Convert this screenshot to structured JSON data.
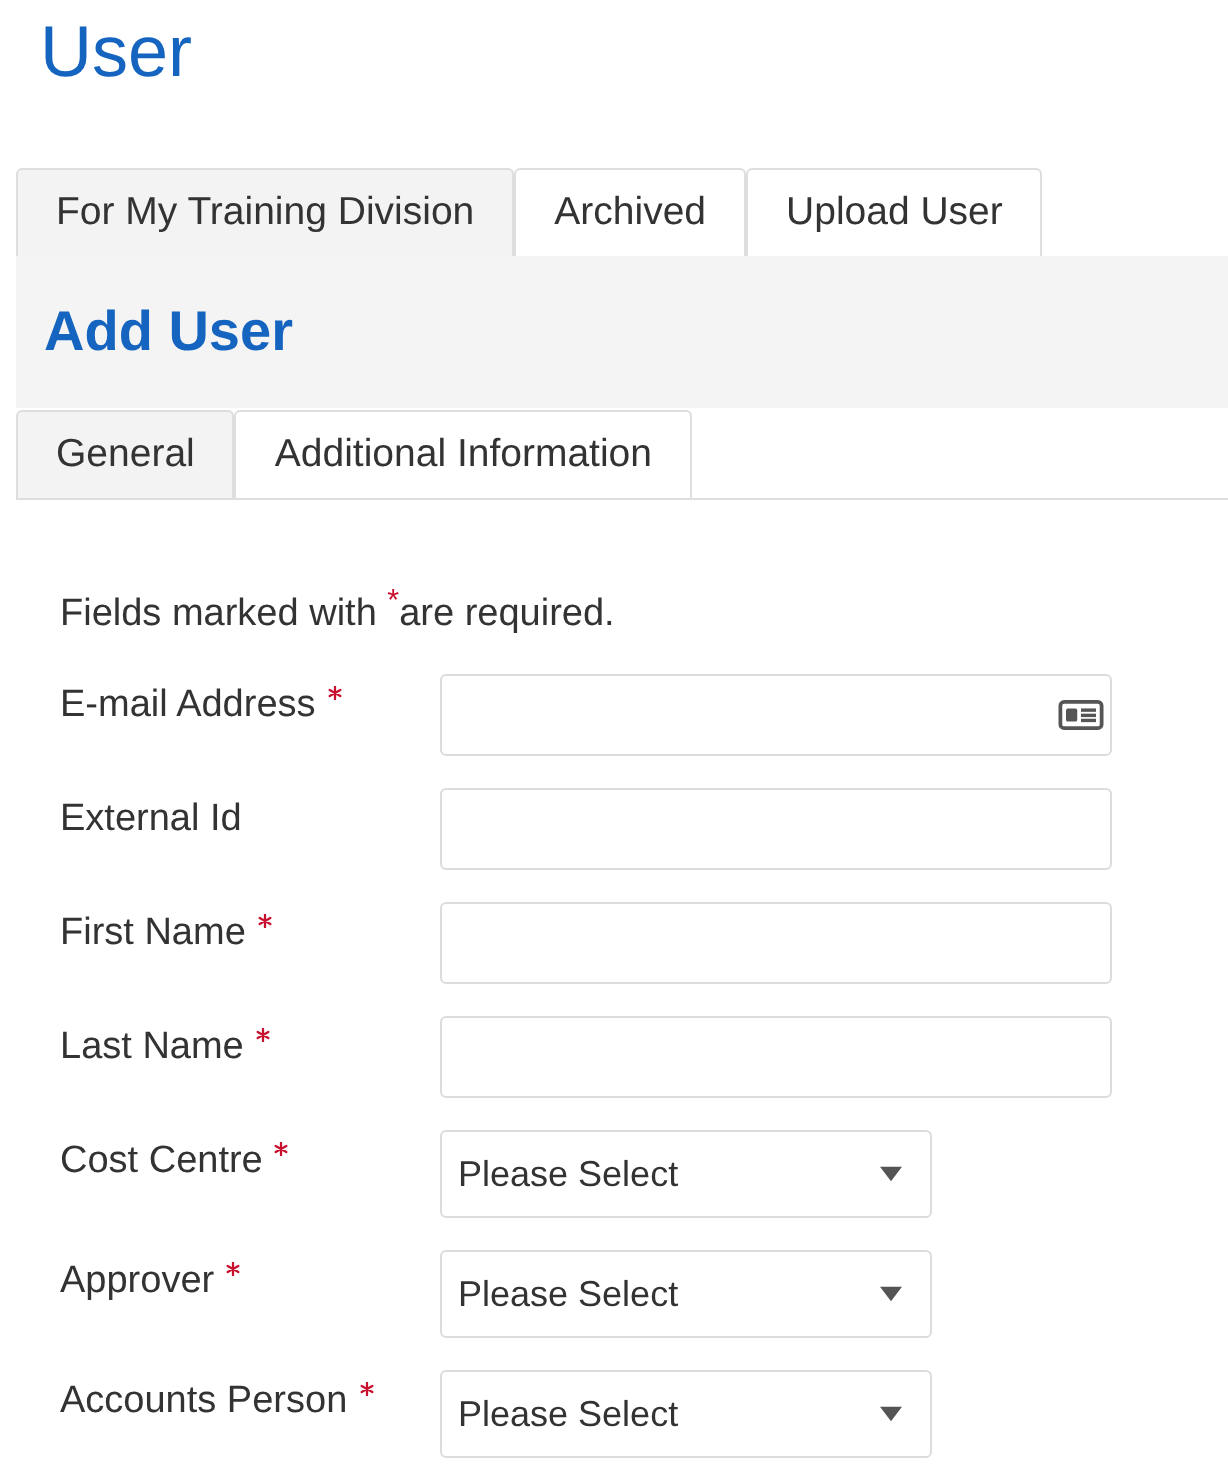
{
  "page": {
    "title": "User"
  },
  "tabs": [
    {
      "label": "For My Training Division",
      "selected": true
    },
    {
      "label": "Archived",
      "selected": false
    },
    {
      "label": "Upload User",
      "selected": false
    }
  ],
  "panel": {
    "title": "Add User"
  },
  "subtabs": [
    {
      "label": "General",
      "selected": true
    },
    {
      "label": "Additional Information",
      "selected": false
    }
  ],
  "form": {
    "note": "Fields marked with $^{*}$are required.",
    "fields": [
      {
        "kind": "email",
        "label": "E-mail Address",
        "required": true
      },
      {
        "kind": "text",
        "label": "External Id",
        "required": false
      },
      {
        "kind": "text",
        "label": "First Name",
        "required": true
      },
      {
        "kind": "text",
        "label": "Last Name",
        "required": true
      },
      {
        "kind": "select",
        "label": "Cost Centre",
        "required": true,
        "value": "Please Select"
      },
      {
        "kind": "select",
        "label": "Approver",
        "required": true,
        "value": "Please Select"
      },
      {
        "kind": "select",
        "label": "Accounts Person",
        "required": true,
        "value": "Please Select"
      }
    ]
  }
}
